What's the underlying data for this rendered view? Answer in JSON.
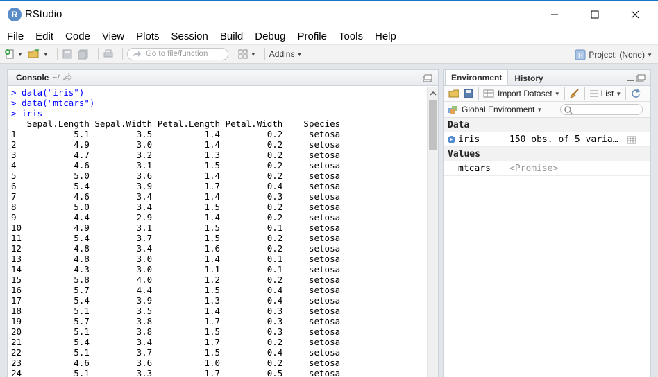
{
  "window": {
    "title": "RStudio",
    "logo_letter": "R"
  },
  "menu": [
    "File",
    "Edit",
    "Code",
    "View",
    "Plots",
    "Session",
    "Build",
    "Debug",
    "Profile",
    "Tools",
    "Help"
  ],
  "toolbar": {
    "goto_placeholder": "Go to file/function",
    "addins_label": "Addins",
    "project_label": "Project: (None)"
  },
  "console": {
    "title": "Console",
    "working_dir": "~/",
    "commands": [
      "> data(\"iris\")",
      "> data(\"mtcars\")",
      "> iris"
    ],
    "table_header": "   Sepal.Length Sepal.Width Petal.Length Petal.Width    Species",
    "table_rows": [
      "1           5.1         3.5          1.4         0.2     setosa",
      "2           4.9         3.0          1.4         0.2     setosa",
      "3           4.7         3.2          1.3         0.2     setosa",
      "4           4.6         3.1          1.5         0.2     setosa",
      "5           5.0         3.6          1.4         0.2     setosa",
      "6           5.4         3.9          1.7         0.4     setosa",
      "7           4.6         3.4          1.4         0.3     setosa",
      "8           5.0         3.4          1.5         0.2     setosa",
      "9           4.4         2.9          1.4         0.2     setosa",
      "10          4.9         3.1          1.5         0.1     setosa",
      "11          5.4         3.7          1.5         0.2     setosa",
      "12          4.8         3.4          1.6         0.2     setosa",
      "13          4.8         3.0          1.4         0.1     setosa",
      "14          4.3         3.0          1.1         0.1     setosa",
      "15          5.8         4.0          1.2         0.2     setosa",
      "16          5.7         4.4          1.5         0.4     setosa",
      "17          5.4         3.9          1.3         0.4     setosa",
      "18          5.1         3.5          1.4         0.3     setosa",
      "19          5.7         3.8          1.7         0.3     setosa",
      "20          5.1         3.8          1.5         0.3     setosa",
      "21          5.4         3.4          1.7         0.2     setosa",
      "22          5.1         3.7          1.5         0.4     setosa",
      "23          4.6         3.6          1.0         0.2     setosa",
      "24          5.1         3.3          1.7         0.5     setosa"
    ]
  },
  "environment": {
    "tabs": [
      "Environment",
      "History"
    ],
    "import_label": "Import Dataset",
    "list_label": "List",
    "scope_label": "Global Environment",
    "data_header": "Data",
    "values_header": "Values",
    "data_rows": [
      {
        "name": "iris",
        "value": "150 obs. of 5 varia…"
      }
    ],
    "value_rows": [
      {
        "name": "mtcars",
        "value": "<Promise>"
      }
    ]
  },
  "colors": {
    "accent": "#0000ff",
    "logo": "#5b8dc9"
  }
}
